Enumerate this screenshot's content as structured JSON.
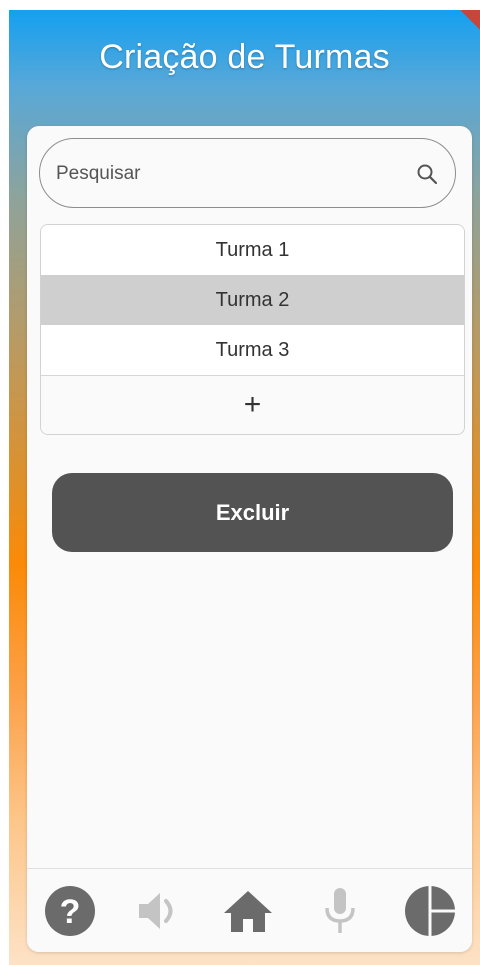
{
  "header": {
    "title": "Criação de Turmas"
  },
  "search": {
    "placeholder": "Pesquisar",
    "value": "",
    "icon": "search-icon"
  },
  "turmas": {
    "items": [
      {
        "label": "Turma 1",
        "selected": false
      },
      {
        "label": "Turma 2",
        "selected": true
      },
      {
        "label": "Turma 3",
        "selected": false
      }
    ],
    "add_label": "+"
  },
  "actions": {
    "delete_label": "Excluir"
  },
  "bottom_nav": {
    "items": [
      {
        "icon": "help-icon",
        "enabled": true
      },
      {
        "icon": "volume-icon",
        "enabled": false
      },
      {
        "icon": "home-icon",
        "enabled": true
      },
      {
        "icon": "microphone-icon",
        "enabled": false
      },
      {
        "icon": "pie-chart-icon",
        "enabled": true
      }
    ]
  },
  "colors": {
    "primary_dark": "#535353",
    "selected_row": "#cfcfcf",
    "icon_active": "#6b6b6b",
    "icon_disabled": "#c4c4c4",
    "gradient_top": "#14a0f0",
    "gradient_mid": "#fb8a07",
    "gradient_bottom": "#fde2c6"
  }
}
